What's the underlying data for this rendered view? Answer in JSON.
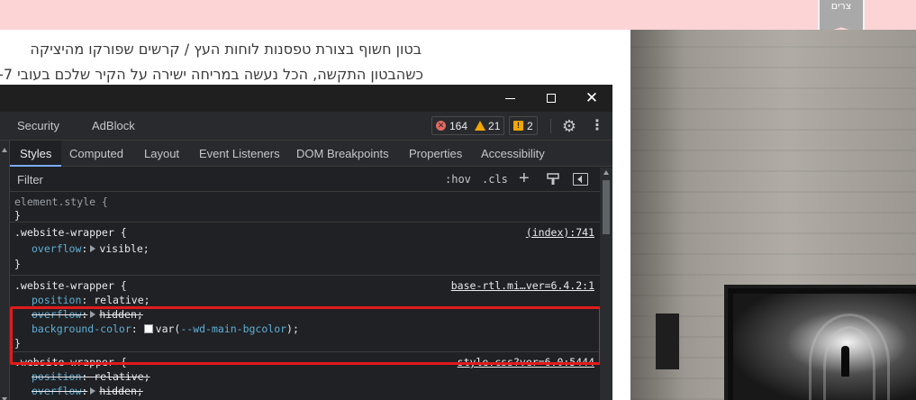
{
  "site": {
    "badge_text": "צרים",
    "line1": "בטון חשוף בצורת טפסנות לוחות העץ / קרשים שפורקו מהיציקה",
    "line2": "כשהבטון התקשה, הכל נעשה במריחה ישירה על הקיר שלכם בעובי 7-"
  },
  "window": {
    "minimize_glyph": "",
    "close_glyph": "✕"
  },
  "devtools": {
    "main_tabs": {
      "security": "Security",
      "adblock": "AdBlock"
    },
    "counts": {
      "errors": "164",
      "warnings": "21",
      "issues": "2"
    },
    "icons": {
      "gear": "⚙",
      "kebab": "⋮",
      "plus": "+",
      "error_glyph": "✕",
      "issue_glyph": "!"
    },
    "sub_tabs": {
      "styles": "Styles",
      "computed": "Computed",
      "layout": "Layout",
      "event_listeners": "Event Listeners",
      "dom_breakpoints": "DOM Breakpoints",
      "properties": "Properties",
      "accessibility": "Accessibility"
    },
    "filter": {
      "placeholder": "Filter",
      "hov": ":hov",
      "cls": ".cls"
    },
    "rules": {
      "element_style": {
        "selector": "element.style {",
        "close": "}"
      },
      "rule1": {
        "selector": ".website-wrapper {",
        "source": "(index):741",
        "prop": "overflow",
        "value": "visible;",
        "close": "}"
      },
      "rule2": {
        "selector": ".website-wrapper {",
        "source": "base-rtl.mi…ver=6.4.2:1",
        "p1_name": "position",
        "p1_value": "relative;",
        "p2_name": "overflow",
        "p2_value": "hidden;",
        "p3_name": "background-color",
        "p3_value": "var(--wd-main-bgcolor);",
        "var_name": "--wd-main-bgcolor",
        "close": "}"
      },
      "rule3": {
        "selector": ".website-wrapper {",
        "source": "style.css?ver=6.0:5444",
        "p1_name": "position",
        "p1_value": "relative;",
        "p2_name": "overflow",
        "p2_value": "hidden;"
      }
    }
  }
}
